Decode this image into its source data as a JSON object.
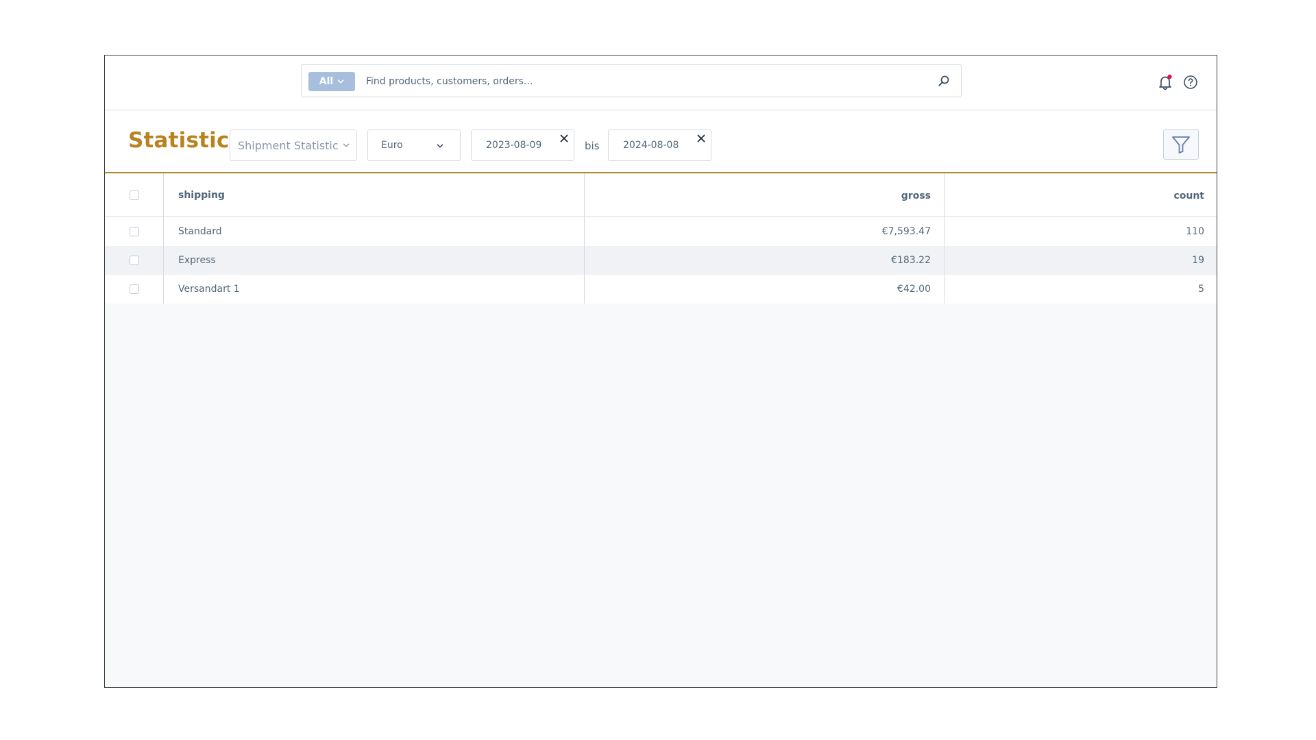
{
  "search": {
    "scope_label": "All",
    "placeholder": "Find products, customers, orders..."
  },
  "toolbar": {
    "title": "Statistic",
    "statistic_type": "Shipment Statistic",
    "currency": "Euro",
    "date_from": "2023-08-09",
    "date_to": "2024-08-08",
    "range_separator": "bis"
  },
  "table": {
    "columns": [
      "shipping",
      "gross",
      "count"
    ],
    "rows": [
      {
        "shipping": "Standard",
        "gross": "€7,593.47",
        "count": "110"
      },
      {
        "shipping": "Express",
        "gross": "€183.22",
        "count": "19"
      },
      {
        "shipping": "Versandart 1",
        "gross": "€42.00",
        "count": "5"
      }
    ]
  },
  "colors": {
    "accent": "#b8831f",
    "notification_dot": "#e0134a",
    "scope_button": "#a7bfdc"
  }
}
